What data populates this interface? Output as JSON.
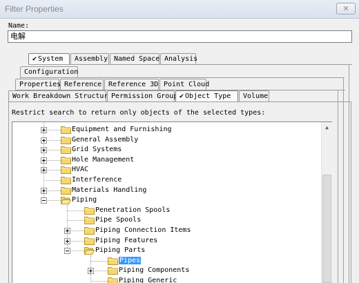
{
  "window": {
    "title": "Filter Properties",
    "close_glyph": "✕"
  },
  "name_field": {
    "label": "Name:",
    "value": "电解"
  },
  "tab_rows": [
    [
      {
        "label": "System",
        "checked": true,
        "selected": true
      },
      {
        "label": "Assembly"
      },
      {
        "label": "Named Space"
      },
      {
        "label": "Analysis"
      }
    ],
    [
      {
        "label": "Configuration"
      }
    ],
    [
      {
        "label": "Properties"
      },
      {
        "label": "Reference"
      },
      {
        "label": "Reference 3D"
      },
      {
        "label": "Point Cloud"
      }
    ],
    [
      {
        "label": "Work Breakdown Structure"
      },
      {
        "label": "Permission Group"
      },
      {
        "label": "Object Type",
        "checked": true,
        "selected": true
      },
      {
        "label": "Volume"
      }
    ]
  ],
  "check_glyph": "✔",
  "restrict_label": "Restrict search to return only objects of the selected types:",
  "tree": {
    "items": [
      {
        "label": "Equipment and Furnishing",
        "level": 0,
        "expander": "plus"
      },
      {
        "label": "General Assembly",
        "level": 0,
        "expander": "plus"
      },
      {
        "label": "Grid Systems",
        "level": 0,
        "expander": "plus"
      },
      {
        "label": "Hole Management",
        "level": 0,
        "expander": "plus"
      },
      {
        "label": "HVAC",
        "level": 0,
        "expander": "plus"
      },
      {
        "label": "Interference",
        "level": 0,
        "expander": "none"
      },
      {
        "label": "Materials Handling",
        "level": 0,
        "expander": "plus"
      },
      {
        "label": "Piping",
        "level": 0,
        "expander": "minus",
        "open": true
      },
      {
        "label": "Penetration Spools",
        "level": 1,
        "expander": "none"
      },
      {
        "label": "Pipe Spools",
        "level": 1,
        "expander": "none"
      },
      {
        "label": "Piping Connection Items",
        "level": 1,
        "expander": "plus"
      },
      {
        "label": "Piping Features",
        "level": 1,
        "expander": "plus"
      },
      {
        "label": "Piping Parts",
        "level": 1,
        "expander": "minus",
        "open": true
      },
      {
        "label": "Pipes",
        "level": 2,
        "expander": "none",
        "selected": true
      },
      {
        "label": "Piping Components",
        "level": 2,
        "expander": "plus"
      },
      {
        "label": "Piping Generic",
        "level": 2,
        "expander": "none"
      }
    ]
  },
  "scrollbar": {
    "up_glyph": "▲"
  },
  "colors": {
    "selection": "#3399ff",
    "folder_fill": "#f5d76e",
    "folder_stroke": "#b8962e"
  }
}
